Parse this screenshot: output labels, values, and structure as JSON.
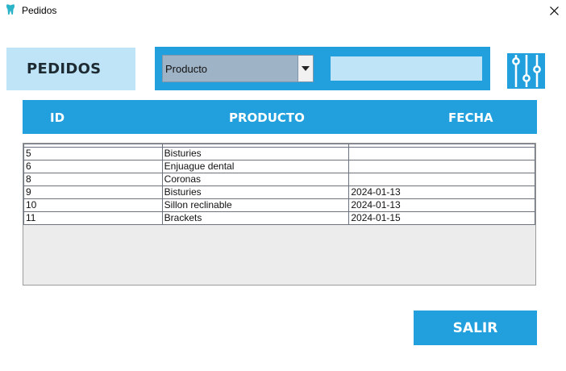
{
  "window": {
    "title": "Pedidos"
  },
  "section": {
    "label": "PEDIDOS"
  },
  "filter": {
    "selected_option": "Producto",
    "search_value": ""
  },
  "table": {
    "columns": [
      "ID",
      "PRODUCTO",
      "FECHA"
    ],
    "rows": [
      {
        "id": "",
        "producto": "",
        "fecha": ""
      },
      {
        "id": "5",
        "producto": "Bisturies",
        "fecha": ""
      },
      {
        "id": "6",
        "producto": "Enjuague dental",
        "fecha": ""
      },
      {
        "id": "8",
        "producto": "Coronas",
        "fecha": ""
      },
      {
        "id": "9",
        "producto": "Bisturies",
        "fecha": "2024-01-13"
      },
      {
        "id": "10",
        "producto": "Sillon reclinable",
        "fecha": "2024-01-13"
      },
      {
        "id": "11",
        "producto": "Brackets",
        "fecha": "2024-01-15"
      }
    ]
  },
  "buttons": {
    "exit_label": "SALIR"
  },
  "colors": {
    "accent": "#22a0dd",
    "light_accent": "#bfe4f8",
    "select_bg": "#9fb3c7"
  },
  "icons": {
    "app": "tooth-icon",
    "close": "close-icon",
    "dropdown": "chevron-down-icon",
    "filter": "sliders-icon"
  }
}
